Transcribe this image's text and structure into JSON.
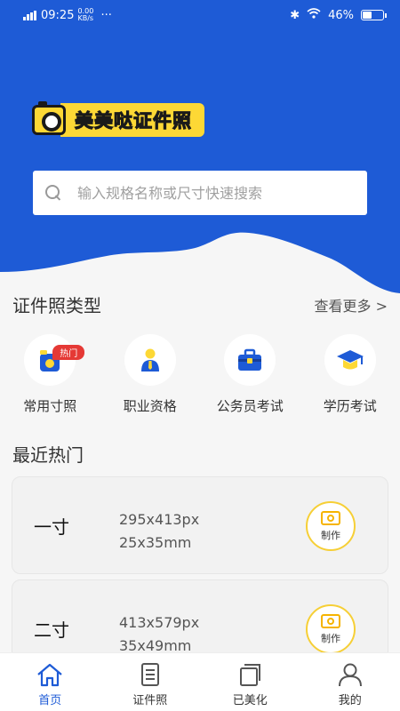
{
  "status_bar": {
    "time": "09:25",
    "data_speed": "0.00 KB/s",
    "battery": "46%"
  },
  "brand": {
    "title": "美美哒证件照"
  },
  "search": {
    "placeholder": "输入规格名称或尺寸快速搜索"
  },
  "id_types": {
    "title": "证件照类型",
    "more": "查看更多 >",
    "items": [
      {
        "label": "常用寸照",
        "icon": "common-size-icon",
        "badge": "热门"
      },
      {
        "label": "职业资格",
        "icon": "professional-icon"
      },
      {
        "label": "公务员考试",
        "icon": "briefcase-icon"
      },
      {
        "label": "学历考试",
        "icon": "graduation-cap-icon"
      }
    ]
  },
  "recent": {
    "title": "最近热门",
    "items": [
      {
        "name": "一寸",
        "px": "295x413px",
        "mm": "25x35mm",
        "action": "制作"
      },
      {
        "name": "二寸",
        "px": "413x579px",
        "mm": "35x49mm",
        "action": "制作"
      }
    ]
  },
  "tabbar": {
    "items": [
      {
        "label": "首页",
        "icon": "home-icon",
        "active": true
      },
      {
        "label": "证件照",
        "icon": "document-icon",
        "active": false
      },
      {
        "label": "已美化",
        "icon": "layers-icon",
        "active": false
      },
      {
        "label": "我的",
        "icon": "user-icon",
        "active": false
      }
    ]
  },
  "colors": {
    "primary": "#1e5bd6",
    "accent": "#fdd835",
    "badge": "#e53935"
  }
}
